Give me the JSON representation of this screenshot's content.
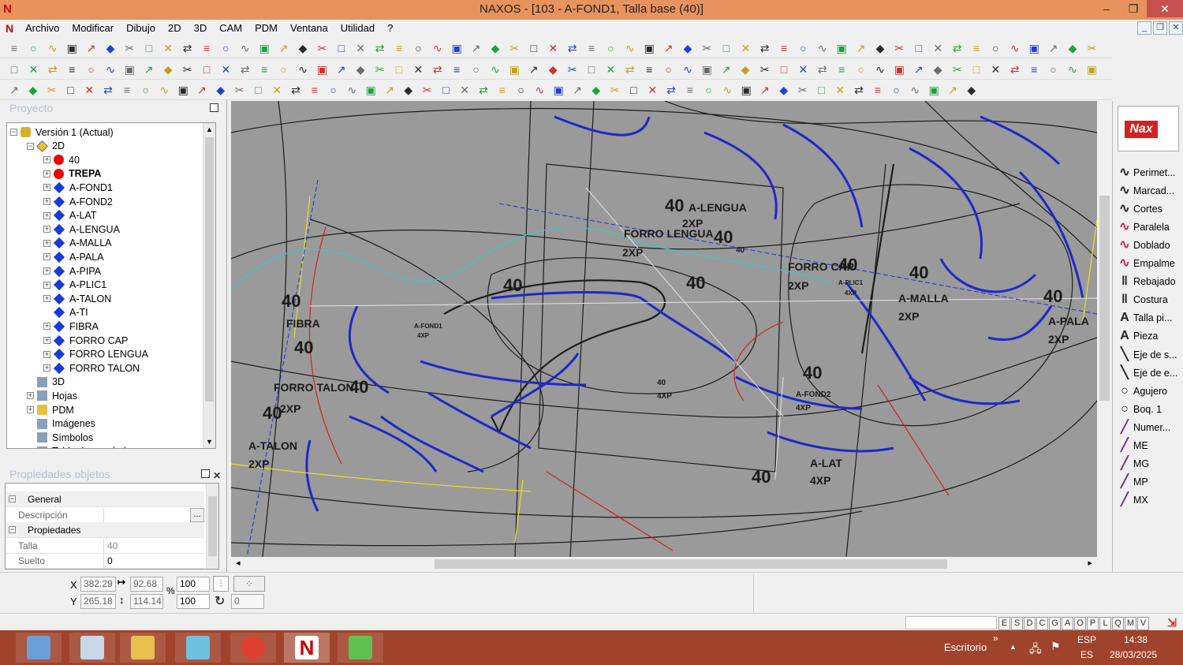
{
  "window": {
    "title": "NAXOS - [103 - A-FOND1, Talla base (40)]",
    "logo_letter": "N",
    "minimize": "–",
    "maximize": "❐",
    "close": "✕"
  },
  "menu": {
    "items": [
      "Archivo",
      "Modificar",
      "Dibujo",
      "2D",
      "3D",
      "CAM",
      "PDM",
      "Ventana",
      "Utilidad",
      "?"
    ]
  },
  "mdi_controls": [
    "_",
    "❐",
    "✕"
  ],
  "project_panel": {
    "header": "Proyecto",
    "tree": [
      {
        "label": "Versión 1 (Actual)",
        "level": 0,
        "icon": "version-icon",
        "expander": "−"
      },
      {
        "label": "2D",
        "level": 1,
        "icon": "2d-layer-icon",
        "expander": "−"
      },
      {
        "label": "40",
        "level": 2,
        "icon": "red-dot-icon",
        "expander": "+"
      },
      {
        "label": "TREPA",
        "level": 2,
        "icon": "red-dot-icon",
        "expander": "+",
        "bold": true
      },
      {
        "label": "A-FOND1",
        "level": 2,
        "icon": "blue-diamond-icon",
        "expander": "+"
      },
      {
        "label": "A-FOND2",
        "level": 2,
        "icon": "blue-diamond-icon",
        "expander": "+"
      },
      {
        "label": "A-LAT",
        "level": 2,
        "icon": "blue-diamond-icon",
        "expander": "+"
      },
      {
        "label": "A-LENGUA",
        "level": 2,
        "icon": "blue-diamond-icon",
        "expander": "+"
      },
      {
        "label": "A-MALLA",
        "level": 2,
        "icon": "blue-diamond-icon",
        "expander": "+"
      },
      {
        "label": "A-PALA",
        "level": 2,
        "icon": "blue-diamond-icon",
        "expander": "+"
      },
      {
        "label": "A-PIPA",
        "level": 2,
        "icon": "blue-diamond-icon",
        "expander": "+"
      },
      {
        "label": "A-PLIC1",
        "level": 2,
        "icon": "blue-diamond-icon",
        "expander": "+"
      },
      {
        "label": "A-TALON",
        "level": 2,
        "icon": "blue-diamond-icon",
        "expander": "+"
      },
      {
        "label": "A-TI",
        "level": 2,
        "icon": "blue-diamond-icon",
        "expander": ""
      },
      {
        "label": "FIBRA",
        "level": 2,
        "icon": "blue-diamond-icon",
        "expander": "+"
      },
      {
        "label": "FORRO CAP",
        "level": 2,
        "icon": "blue-diamond-icon",
        "expander": "+"
      },
      {
        "label": "FORRO LENGUA",
        "level": 2,
        "icon": "blue-diamond-icon",
        "expander": "+"
      },
      {
        "label": "FORRO TALON",
        "level": 2,
        "icon": "blue-diamond-icon",
        "expander": "+"
      },
      {
        "label": "3D",
        "level": 1,
        "icon": "3d-layer-icon",
        "expander": ""
      },
      {
        "label": "Hojas",
        "level": 1,
        "icon": "sheets-icon",
        "expander": "+"
      },
      {
        "label": "PDM",
        "level": 1,
        "icon": "folder-icon",
        "expander": "+"
      },
      {
        "label": "Imágenes",
        "level": 1,
        "icon": "images-icon",
        "expander": ""
      },
      {
        "label": "Símbolos",
        "level": 1,
        "icon": "symbols-icon",
        "expander": ""
      },
      {
        "label": "Tabla de escalado",
        "level": 1,
        "icon": "table-icon",
        "expander": "+"
      }
    ]
  },
  "properties_panel": {
    "header": "Propiedades objetos",
    "rows": [
      {
        "type": "section",
        "label": "General"
      },
      {
        "type": "field",
        "label": "Descripción",
        "value": "",
        "has_button": true,
        "button": "..."
      },
      {
        "type": "section",
        "label": "Propiedades"
      },
      {
        "type": "field",
        "label": "Talla",
        "value": "40"
      },
      {
        "type": "field",
        "label": "Suelto",
        "value": "0"
      }
    ]
  },
  "drawing": {
    "labels": [
      {
        "text": "40",
        "size": "big"
      },
      {
        "text": "A-LENGUA"
      },
      {
        "text": "2XP"
      },
      {
        "text": "FORRO LENGUA"
      },
      {
        "text": "2XP"
      },
      {
        "text": "40",
        "size": "big"
      },
      {
        "text": "FORRO CAP"
      },
      {
        "text": "40",
        "size": "big"
      },
      {
        "text": "2XP"
      },
      {
        "text": "40",
        "size": "big"
      },
      {
        "text": "A-MALLA"
      },
      {
        "text": "2XP"
      },
      {
        "text": "40",
        "size": "big"
      },
      {
        "text": "A-PALA"
      },
      {
        "text": "2XP"
      },
      {
        "text": "40",
        "size": "big"
      },
      {
        "text": "40",
        "size": "big"
      },
      {
        "text": "40",
        "size": "big"
      },
      {
        "text": "FIBRA"
      },
      {
        "text": "40",
        "size": "big"
      },
      {
        "text": "FORRO TALON"
      },
      {
        "text": "40",
        "size": "big"
      },
      {
        "text": "2XP"
      },
      {
        "text": "40",
        "size": "big"
      },
      {
        "text": "A-TALON"
      },
      {
        "text": "2XP"
      },
      {
        "text": "A-FOND1"
      },
      {
        "text": "4XP"
      },
      {
        "text": "40",
        "size": "big"
      },
      {
        "text": "A-FOND2"
      },
      {
        "text": "4XP"
      },
      {
        "text": "40"
      },
      {
        "text": "4XP"
      },
      {
        "text": "40",
        "size": "big"
      },
      {
        "text": "A-LAT"
      },
      {
        "text": "4XP"
      },
      {
        "text": "A-PLIC1"
      },
      {
        "text": "4XP"
      },
      {
        "text": "40"
      }
    ],
    "colors": {
      "background": "#9a9a9a",
      "outline": "#1c1c1c",
      "blue": "#1e28c8",
      "red": "#d42020",
      "yellow": "#e8e020",
      "cyan": "#3cc8c8",
      "white": "#e6e6e6"
    }
  },
  "right_panel": {
    "logo_text": "Nax",
    "items": [
      {
        "label": "Perimet...",
        "icon": "perimeter-icon"
      },
      {
        "label": "Marcad...",
        "icon": "marker-icon"
      },
      {
        "label": "Cortes",
        "icon": "cuts-icon"
      },
      {
        "label": "Paralela",
        "icon": "parallel-icon"
      },
      {
        "label": "Doblado",
        "icon": "fold-icon"
      },
      {
        "label": "Empalme",
        "icon": "join-icon"
      },
      {
        "label": "Rebajado",
        "icon": "skive-icon"
      },
      {
        "label": "Costura",
        "icon": "seam-icon"
      },
      {
        "label": "Talla pi...",
        "icon": "size-text-icon"
      },
      {
        "label": "Pieza",
        "icon": "piece-text-icon"
      },
      {
        "label": "Eje de s...",
        "icon": "axis-icon"
      },
      {
        "label": "Eje de e...",
        "icon": "axis-icon"
      },
      {
        "label": "Agujero",
        "icon": "hole-icon"
      },
      {
        "label": "Boq. 1",
        "icon": "punch-icon"
      },
      {
        "label": "Numer...",
        "icon": "number-icon"
      },
      {
        "label": "ME",
        "icon": "mark-icon"
      },
      {
        "label": "MG",
        "icon": "mark-icon"
      },
      {
        "label": "MP",
        "icon": "mark-icon"
      },
      {
        "label": "MX",
        "icon": "mark-icon"
      }
    ]
  },
  "coordinates": {
    "x_label": "X",
    "y_label": "Y",
    "x": "382.29",
    "y": "265.18",
    "dx": "92.68",
    "dy": "114.14",
    "scale_x": "100",
    "scale_y": "100",
    "percent": "%",
    "angle": "0"
  },
  "statusbar": {
    "modes": [
      "E",
      "S",
      "D",
      "C",
      "G",
      "A",
      "O",
      "P",
      "L",
      "Q",
      "M",
      "V"
    ]
  },
  "taskbar": {
    "desktop_label": "Escritorio",
    "desktop_arrow": "»",
    "language": "ESP",
    "layout": "ES",
    "time": "14:38",
    "date": "28/03/2025",
    "tray_arrow": "▲",
    "apps": [
      "calculator-app-icon",
      "explorer-app-icon",
      "folder-app-icon",
      "notebook-app-icon",
      "chrome-app-icon",
      "naxos-app-icon",
      "green-app-icon"
    ]
  }
}
